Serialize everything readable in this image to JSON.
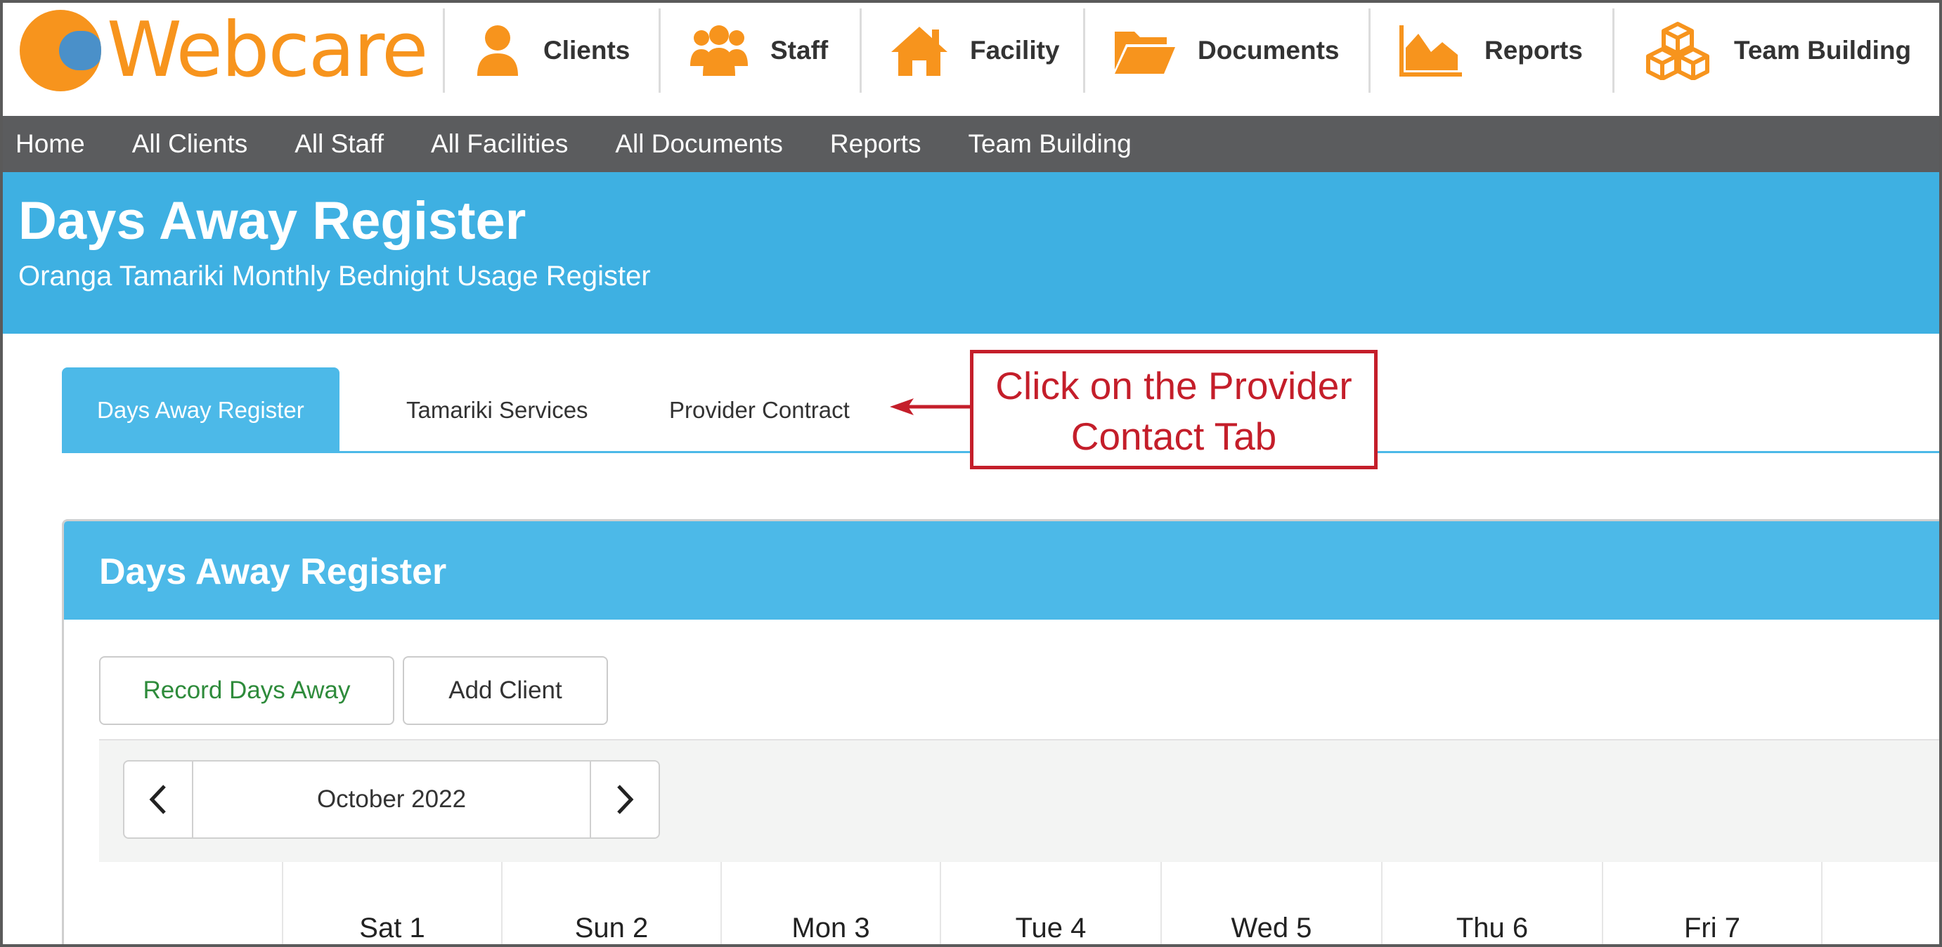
{
  "app": {
    "brand": "Webcare",
    "modules": [
      {
        "label": "Clients",
        "icon": "person-icon"
      },
      {
        "label": "Staff",
        "icon": "group-icon"
      },
      {
        "label": "Facility",
        "icon": "house-icon"
      },
      {
        "label": "Documents",
        "icon": "folder-icon"
      },
      {
        "label": "Reports",
        "icon": "chart-icon"
      },
      {
        "label": "Team Building",
        "icon": "boxes-icon"
      }
    ]
  },
  "nav": [
    "Home",
    "All Clients",
    "All Staff",
    "All Facilities",
    "All Documents",
    "Reports",
    "Team Building"
  ],
  "header": {
    "title": "Days Away Register",
    "subtitle": "Oranga Tamariki Monthly Bednight Usage Register"
  },
  "tabs": [
    "Days Away Register",
    "Tamariki Services",
    "Provider Contract"
  ],
  "annotation": {
    "line1": "Click on the Provider",
    "line2": "Contact Tab"
  },
  "panel": {
    "title": "Days Away Register",
    "record_button": "Record Days Away",
    "add_button": "Add Client",
    "month": "October 2022",
    "days": [
      "Sat 1",
      "Sun 2",
      "Mon 3",
      "Tue 4",
      "Wed 5",
      "Thu 6",
      "Fri 7"
    ]
  },
  "colors": {
    "accent": "#3eb0e2",
    "brand_orange": "#f7941d",
    "nav_bg": "#5b5c5e",
    "annotation_red": "#c41e2a",
    "record_green": "#2e8b3b"
  }
}
